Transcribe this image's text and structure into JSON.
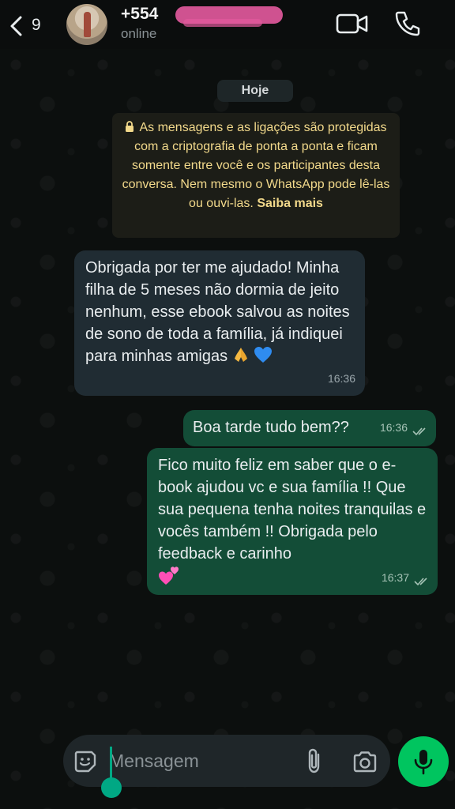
{
  "header": {
    "back_count": "9",
    "contact_name": "+554",
    "status": "online"
  },
  "chat": {
    "day_label": "Hoje",
    "encryption_notice": "As mensagens e as ligações são protegidas com a criptografia de ponta a ponta e ficam somente entre você e os participantes desta conversa. Nem mesmo o WhatsApp pode lê-las ou ouvi-las.",
    "encryption_more": "Saiba mais",
    "messages": [
      {
        "direction": "incoming",
        "text": "Obrigada por ter me ajudado! Minha filha de 5 meses não dormia de jeito nenhum, esse ebook salvou as noites de sono de toda a família, já indiquei para minhas amigas",
        "emoji": [
          "pray-emoji",
          "blue-heart-emoji"
        ],
        "time": "16:36"
      },
      {
        "direction": "outgoing",
        "text": "Boa tarde tudo bem??",
        "time": "16:36",
        "status": "delivered"
      },
      {
        "direction": "outgoing",
        "text": "Fico muito feliz em saber que o e-book ajudou vc e sua família !! Que sua pequena tenha noites tranquilas e vocês também !! Obrigada pelo feedback e carinho",
        "emoji": [
          "two-hearts-emoji"
        ],
        "time": "16:37",
        "status": "delivered"
      }
    ]
  },
  "composer": {
    "placeholder": "Mensagem"
  },
  "colors": {
    "incoming_bubble": "#202c33",
    "outgoing_bubble": "#134d37",
    "mic_button": "#00c55f",
    "notice_text": "#f2d98b"
  }
}
